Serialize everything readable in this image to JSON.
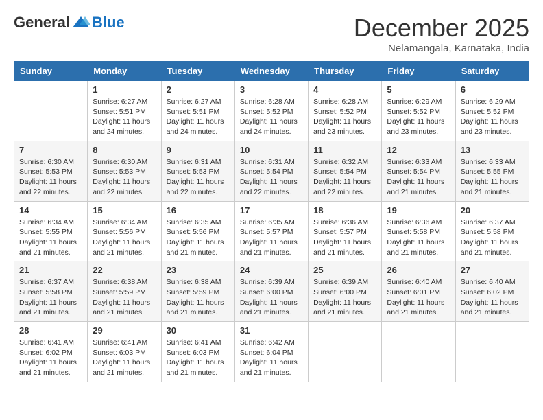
{
  "logo": {
    "general": "General",
    "blue": "Blue"
  },
  "title": "December 2025",
  "location": "Nelamangala, Karnataka, India",
  "weekdays": [
    "Sunday",
    "Monday",
    "Tuesday",
    "Wednesday",
    "Thursday",
    "Friday",
    "Saturday"
  ],
  "weeks": [
    [
      {
        "day": "",
        "info": ""
      },
      {
        "day": "1",
        "info": "Sunrise: 6:27 AM\nSunset: 5:51 PM\nDaylight: 11 hours and 24 minutes."
      },
      {
        "day": "2",
        "info": "Sunrise: 6:27 AM\nSunset: 5:51 PM\nDaylight: 11 hours and 24 minutes."
      },
      {
        "day": "3",
        "info": "Sunrise: 6:28 AM\nSunset: 5:52 PM\nDaylight: 11 hours and 24 minutes."
      },
      {
        "day": "4",
        "info": "Sunrise: 6:28 AM\nSunset: 5:52 PM\nDaylight: 11 hours and 23 minutes."
      },
      {
        "day": "5",
        "info": "Sunrise: 6:29 AM\nSunset: 5:52 PM\nDaylight: 11 hours and 23 minutes."
      },
      {
        "day": "6",
        "info": "Sunrise: 6:29 AM\nSunset: 5:52 PM\nDaylight: 11 hours and 23 minutes."
      }
    ],
    [
      {
        "day": "7",
        "info": "Sunrise: 6:30 AM\nSunset: 5:53 PM\nDaylight: 11 hours and 22 minutes."
      },
      {
        "day": "8",
        "info": "Sunrise: 6:30 AM\nSunset: 5:53 PM\nDaylight: 11 hours and 22 minutes."
      },
      {
        "day": "9",
        "info": "Sunrise: 6:31 AM\nSunset: 5:53 PM\nDaylight: 11 hours and 22 minutes."
      },
      {
        "day": "10",
        "info": "Sunrise: 6:31 AM\nSunset: 5:54 PM\nDaylight: 11 hours and 22 minutes."
      },
      {
        "day": "11",
        "info": "Sunrise: 6:32 AM\nSunset: 5:54 PM\nDaylight: 11 hours and 22 minutes."
      },
      {
        "day": "12",
        "info": "Sunrise: 6:33 AM\nSunset: 5:54 PM\nDaylight: 11 hours and 21 minutes."
      },
      {
        "day": "13",
        "info": "Sunrise: 6:33 AM\nSunset: 5:55 PM\nDaylight: 11 hours and 21 minutes."
      }
    ],
    [
      {
        "day": "14",
        "info": "Sunrise: 6:34 AM\nSunset: 5:55 PM\nDaylight: 11 hours and 21 minutes."
      },
      {
        "day": "15",
        "info": "Sunrise: 6:34 AM\nSunset: 5:56 PM\nDaylight: 11 hours and 21 minutes."
      },
      {
        "day": "16",
        "info": "Sunrise: 6:35 AM\nSunset: 5:56 PM\nDaylight: 11 hours and 21 minutes."
      },
      {
        "day": "17",
        "info": "Sunrise: 6:35 AM\nSunset: 5:57 PM\nDaylight: 11 hours and 21 minutes."
      },
      {
        "day": "18",
        "info": "Sunrise: 6:36 AM\nSunset: 5:57 PM\nDaylight: 11 hours and 21 minutes."
      },
      {
        "day": "19",
        "info": "Sunrise: 6:36 AM\nSunset: 5:58 PM\nDaylight: 11 hours and 21 minutes."
      },
      {
        "day": "20",
        "info": "Sunrise: 6:37 AM\nSunset: 5:58 PM\nDaylight: 11 hours and 21 minutes."
      }
    ],
    [
      {
        "day": "21",
        "info": "Sunrise: 6:37 AM\nSunset: 5:58 PM\nDaylight: 11 hours and 21 minutes."
      },
      {
        "day": "22",
        "info": "Sunrise: 6:38 AM\nSunset: 5:59 PM\nDaylight: 11 hours and 21 minutes."
      },
      {
        "day": "23",
        "info": "Sunrise: 6:38 AM\nSunset: 5:59 PM\nDaylight: 11 hours and 21 minutes."
      },
      {
        "day": "24",
        "info": "Sunrise: 6:39 AM\nSunset: 6:00 PM\nDaylight: 11 hours and 21 minutes."
      },
      {
        "day": "25",
        "info": "Sunrise: 6:39 AM\nSunset: 6:00 PM\nDaylight: 11 hours and 21 minutes."
      },
      {
        "day": "26",
        "info": "Sunrise: 6:40 AM\nSunset: 6:01 PM\nDaylight: 11 hours and 21 minutes."
      },
      {
        "day": "27",
        "info": "Sunrise: 6:40 AM\nSunset: 6:02 PM\nDaylight: 11 hours and 21 minutes."
      }
    ],
    [
      {
        "day": "28",
        "info": "Sunrise: 6:41 AM\nSunset: 6:02 PM\nDaylight: 11 hours and 21 minutes."
      },
      {
        "day": "29",
        "info": "Sunrise: 6:41 AM\nSunset: 6:03 PM\nDaylight: 11 hours and 21 minutes."
      },
      {
        "day": "30",
        "info": "Sunrise: 6:41 AM\nSunset: 6:03 PM\nDaylight: 11 hours and 21 minutes."
      },
      {
        "day": "31",
        "info": "Sunrise: 6:42 AM\nSunset: 6:04 PM\nDaylight: 11 hours and 21 minutes."
      },
      {
        "day": "",
        "info": ""
      },
      {
        "day": "",
        "info": ""
      },
      {
        "day": "",
        "info": ""
      }
    ]
  ]
}
